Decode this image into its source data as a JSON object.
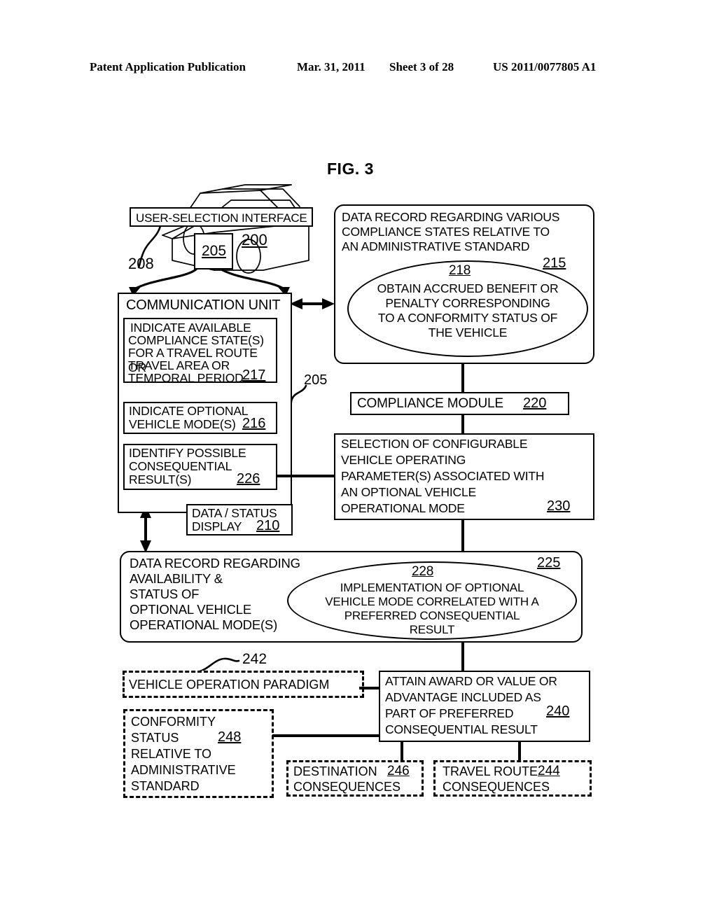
{
  "header": {
    "publication": "Patent Application Publication",
    "date": "Mar. 31, 2011",
    "sheet": "Sheet 3 of 28",
    "number": "US 2011/0077805 A1"
  },
  "figure": {
    "title": "FIG. 3"
  },
  "diagram": {
    "user_selection_interface": {
      "label": "USER-SELECTION INTERFACE",
      "ref_208": "208",
      "ref_205": "205",
      "ref_200": "200"
    },
    "communication_unit": {
      "label": "COMMUNICATION UNIT",
      "ref_205_callout": "205",
      "sub_217": {
        "line1": "INDICATE AVAILABLE",
        "line2": "COMPLIANCE STATE(S)",
        "line3": "FOR A TRAVEL ROUTE OR",
        "line4": "TRAVEL AREA OR",
        "line5": "TEMPORAL PERIOD",
        "ref": "217"
      },
      "sub_216": {
        "line1": "INDICATE OPTIONAL",
        "line2": "VEHICLE MODE(S)",
        "ref": "216"
      },
      "sub_226": {
        "line1": "IDENTIFY POSSIBLE",
        "line2": "CONSEQUENTIAL",
        "line3": "RESULT(S)",
        "ref": "226"
      }
    },
    "data_status_display": {
      "line1": "DATA / STATUS",
      "line2": "DISPLAY",
      "ref": "210"
    },
    "box_215": {
      "line1": "DATA RECORD REGARDING VARIOUS",
      "line2": "COMPLIANCE STATES RELATIVE TO",
      "line3": "AN ADMINISTRATIVE STANDARD",
      "ref": "215",
      "ellipse_218": {
        "ref": "218",
        "line1": "OBTAIN ACCRUED BENEFIT OR",
        "line2": "PENALTY CORRESPONDING",
        "line3": "TO A CONFORMITY STATUS OF",
        "line4": "THE VEHICLE"
      }
    },
    "compliance_module": {
      "label": "COMPLIANCE MODULE",
      "ref": "220"
    },
    "box_230": {
      "line1": "SELECTION OF CONFIGURABLE",
      "line2": "VEHICLE OPERATING",
      "line3": "PARAMETER(S) ASSOCIATED WITH",
      "line4": "AN OPTIONAL VEHICLE",
      "line5": "OPERATIONAL MODE",
      "ref": "230"
    },
    "box_225": {
      "line1": "DATA RECORD REGARDING",
      "line2": "AVAILABILITY &",
      "line3": "STATUS OF",
      "line4": "OPTIONAL VEHICLE",
      "line5": "OPERATIONAL MODE(S)",
      "ref": "225",
      "ellipse_228": {
        "ref": "228",
        "line1": "IMPLEMENTATION OF OPTIONAL",
        "line2": "VEHICLE MODE CORRELATED WITH A",
        "line3": "PREFERRED CONSEQUENTIAL",
        "line4": "RESULT"
      }
    },
    "vehicle_operation_paradigm": {
      "label": "VEHICLE OPERATION PARADIGM",
      "ref": "242"
    },
    "box_240": {
      "line1": "ATTAIN AWARD OR VALUE OR",
      "line2": "ADVANTAGE INCLUDED AS",
      "line3": "PART OF PREFERRED",
      "line4": "CONSEQUENTIAL RESULT",
      "ref": "240"
    },
    "box_248": {
      "line1": "CONFORMITY",
      "line2": "STATUS",
      "line3": "RELATIVE TO",
      "line4": "ADMINISTRATIVE",
      "line5": "STANDARD",
      "ref": "248"
    },
    "box_246": {
      "line1": "DESTINATION",
      "line2": "CONSEQUENCES",
      "ref": "246"
    },
    "box_244": {
      "line1": "TRAVEL ROUTE",
      "line2": "CONSEQUENCES",
      "ref": "244"
    }
  },
  "colors": {
    "ink": "#000000",
    "paper": "#ffffff"
  }
}
